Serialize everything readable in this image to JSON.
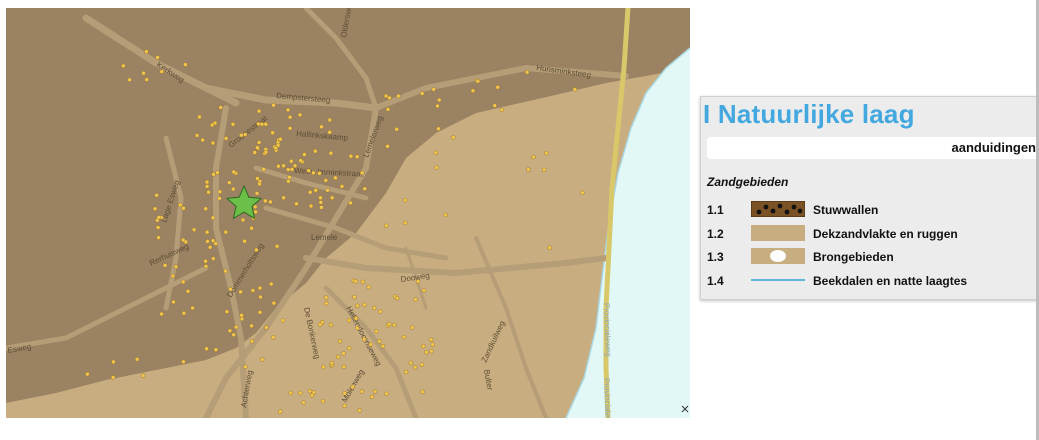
{
  "colors": {
    "highland": "#9a8262",
    "lowland": "#c8ad80",
    "brook_valley": "#e2f8f7",
    "road": "#b59d77",
    "highway_yellow": "#d9c86a",
    "dot": "#f2c64d",
    "star": "#6cc04a",
    "legend_title": "#44a8e0"
  },
  "map": {
    "marker_icon": "star-icon",
    "street_labels": [
      "Kerkweg",
      "Oldersweg",
      "Dempstersteeg",
      "Hunsminksteeg",
      "Groenestraat",
      "Hallinkskaamp",
      "Lemelerweg",
      "Weth. Imminkstraat",
      "Lage Esweg",
      "Lemele",
      "Rerhuisweg",
      "Dommerholtsweg",
      "Dooweg",
      "Provincialeweg",
      "Provincialeweg",
      "De Bonkerweg",
      "Hellendoornseweg",
      "Zandkuilweg",
      "Esweg",
      "Bulter",
      "Achterweg",
      "Molenweg"
    ]
  },
  "legend": {
    "title": "I Natuurlijke laag",
    "subtitle": "aanduidingen",
    "group": "Zandgebieden",
    "items": [
      {
        "code": "1.1",
        "label": "Stuwwallen",
        "swatch": "stuwwallen"
      },
      {
        "code": "1.2",
        "label": "Dekzandvlakte en ruggen",
        "swatch": "dekzand"
      },
      {
        "code": "1.3",
        "label": "Brongebieden",
        "swatch": "brongebieden"
      },
      {
        "code": "1.4",
        "label": "Beekdalen en natte laagtes",
        "swatch": "beekdalen"
      }
    ]
  }
}
